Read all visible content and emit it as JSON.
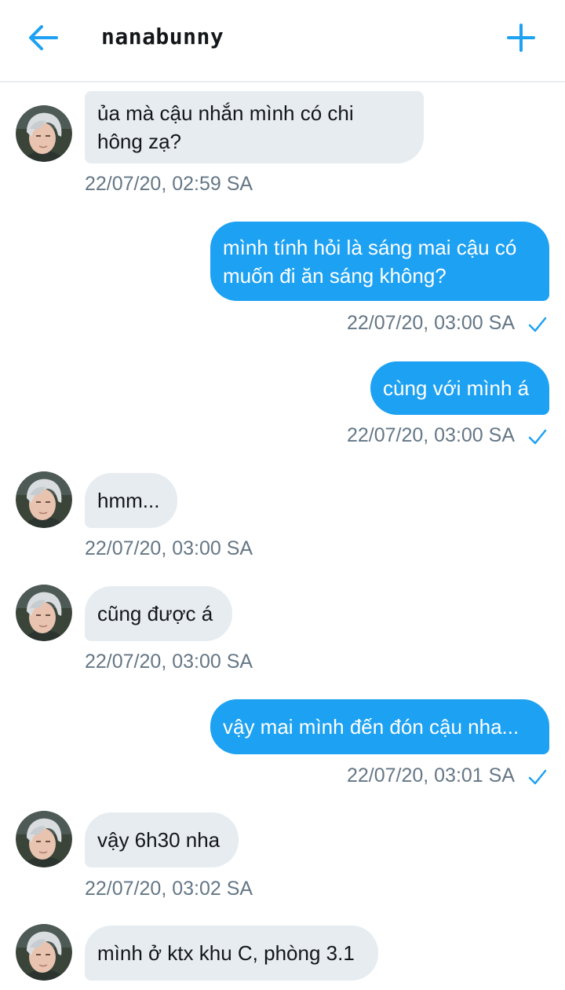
{
  "header": {
    "title": "nanabunny",
    "back_icon": "arrow-left-icon",
    "add_icon": "plus-icon",
    "accent_color": "#1da1f2"
  },
  "messages": [
    {
      "direction": "in",
      "text": "ủa mà cậu nhắn mình có chi\nhông zạ?",
      "timestamp": "22/07/20, 02:59 SA"
    },
    {
      "direction": "out",
      "text": "mình tính hỏi là sáng mai cậu có\nmuốn đi ăn sáng không?",
      "timestamp": "22/07/20, 03:00 SA",
      "status_icon": "checkmark-icon"
    },
    {
      "direction": "out",
      "text": "cùng với mình á",
      "timestamp": "22/07/20, 03:00 SA",
      "status_icon": "checkmark-icon"
    },
    {
      "direction": "in",
      "text": "hmm...",
      "timestamp": "22/07/20, 03:00 SA"
    },
    {
      "direction": "in",
      "text": "cũng được á",
      "timestamp": "22/07/20, 03:00 SA"
    },
    {
      "direction": "out",
      "text": "vậy mai mình đến đón cậu nha...",
      "timestamp": "22/07/20, 03:01 SA",
      "status_icon": "checkmark-icon"
    },
    {
      "direction": "in",
      "text": "vậy 6h30 nha",
      "timestamp": "22/07/20, 03:02 SA"
    },
    {
      "direction": "in",
      "text": "mình ở ktx khu C, phòng 3.1",
      "timestamp": ""
    }
  ],
  "colors": {
    "incoming_bubble": "#e6ecf0",
    "outgoing_bubble": "#1da1f2",
    "timestamp": "#657786"
  }
}
